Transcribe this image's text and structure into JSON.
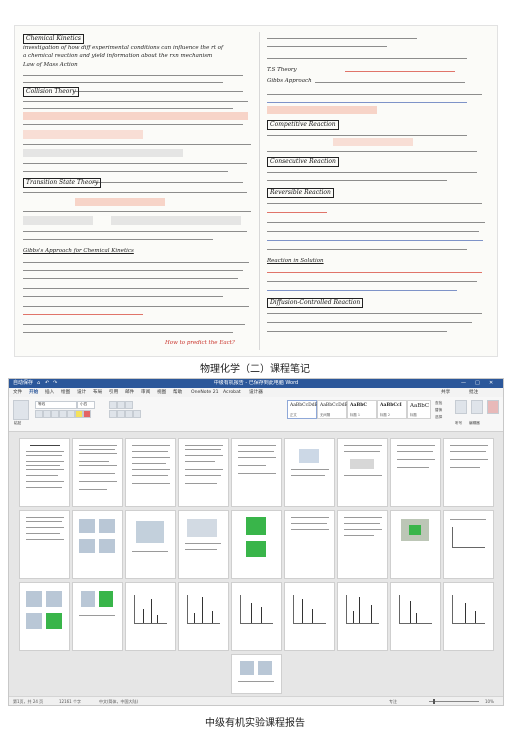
{
  "captions": {
    "notes": "物理化学（二）课程笔记",
    "word": "中级有机实验课程报告"
  },
  "notes": {
    "left": {
      "title": "Chemical Kinetics",
      "line1": "investigation of how diff experimental conditions can influence the rt of",
      "line2": "a chemical reaction and yield information about the rxn mechanism",
      "law": "Law of Mass Action",
      "collision_heading": "Collision Theory",
      "transition_heading": "Transition State Theory",
      "gibbs_heading": "Gibbs's Approach for Chemical Kinetics",
      "bottom_note": "How to predict the Eact?"
    },
    "right": {
      "ts_theory": "T.S Theory",
      "gibbs_approach": "Gibbs Approach",
      "competitive_heading": "Competitive Reaction",
      "consecutive_heading": "Consecutive Reaction",
      "reversible_heading": "Reversible Reaction",
      "solution_heading": "Reaction in Solution",
      "diffusion_heading": "Diffusion-Controlled Reaction"
    }
  },
  "word": {
    "title": "中级有机报告 - 已保存到此电脑  Word",
    "qa_items": [
      "自动保存",
      "⌂",
      "↶",
      "↷"
    ],
    "window_controls": [
      "—",
      "□",
      "✕"
    ],
    "tabs": [
      "文件",
      "开始",
      "插入",
      "绘图",
      "设计",
      "布局",
      "引用",
      "邮件",
      "审阅",
      "视图",
      "帮助",
      "OneNote 21",
      "Acrobat",
      "设计器"
    ],
    "ribbon": {
      "paste": "粘贴",
      "font_name": "等线",
      "font_size": "小四",
      "styles": [
        {
          "sample": "AaBbCcDdE",
          "name": "正文"
        },
        {
          "sample": "AaBbCcDdE",
          "name": "无间隔"
        },
        {
          "sample": "AaBbC",
          "name": "标题 1"
        },
        {
          "sample": "AaBbCcI",
          "name": "标题 2"
        },
        {
          "sample": "AaBbC",
          "name": "标题"
        }
      ],
      "find": "查找",
      "replace": "替换",
      "select": "选择",
      "dictate": "听写",
      "editor": "编辑器",
      "acrobat": "创建和共享 Adobe PDF",
      "share": "共享",
      "comments": "批注"
    },
    "status": {
      "page": "第1页，共 24 页",
      "words": "12161 个字",
      "lang": "中文(简体，中国大陆)",
      "focus": "专注",
      "zoom": "10%"
    }
  }
}
